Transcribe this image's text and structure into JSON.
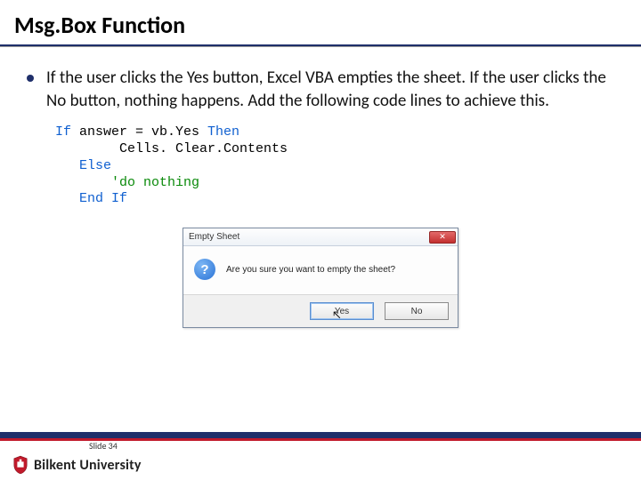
{
  "title": "Msg.Box Function",
  "bullet": "If the user clicks the Yes button, Excel VBA empties the sheet. If the user clicks the No button, nothing happens. Add the following code lines to achieve this.",
  "code": {
    "l1a": "If",
    "l1b": " answer = vb.Yes ",
    "l1c": "Then",
    "l2": "        Cells. Clear.Contents",
    "l3": "   Else",
    "l4a": "       ",
    "l4b": "'do nothing",
    "l5": "   End If"
  },
  "dialog": {
    "title": "Empty Sheet",
    "message": "Are you sure you want to empty the sheet?",
    "yes": "Yes",
    "no": "No",
    "close": "✕"
  },
  "footer": {
    "slide": "Slide 34",
    "university": "Bilkent University"
  }
}
